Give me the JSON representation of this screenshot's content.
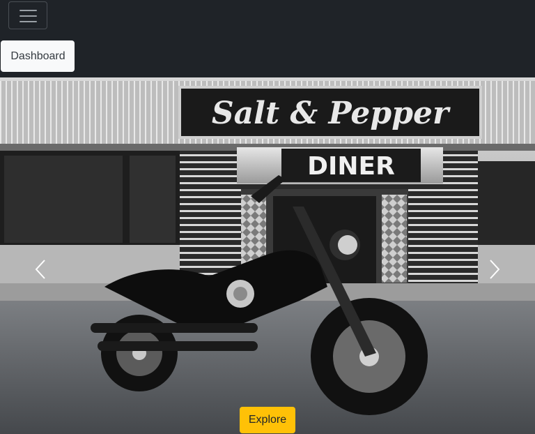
{
  "navbar": {
    "toggler_icon": "hamburger-menu-icon",
    "dashboard_label": "Dashboard"
  },
  "carousel": {
    "image": {
      "sign_top": "Salt & Pepper",
      "sign_bottom": "DINER"
    },
    "prev_icon": "chevron-left-icon",
    "next_icon": "chevron-right-icon",
    "explore_label": "Explore"
  },
  "colors": {
    "navbar_bg": "#1f2328",
    "button_light": "#f8f9fa",
    "button_warning": "#ffc107"
  }
}
